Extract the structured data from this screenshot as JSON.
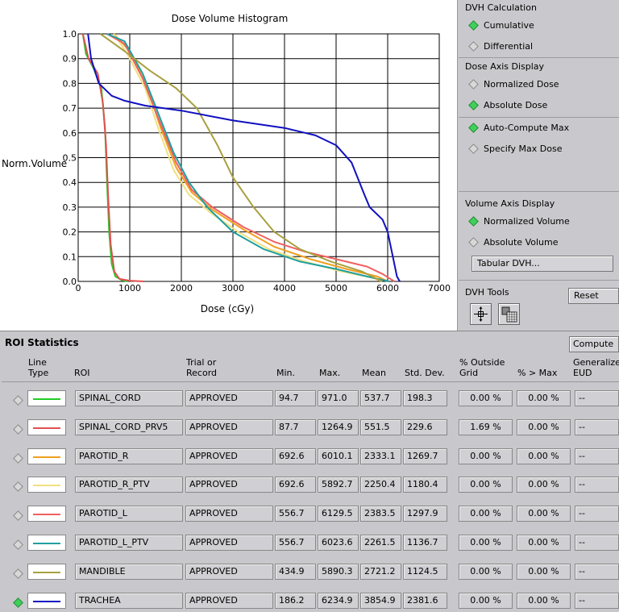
{
  "chart": {
    "title": "Dose Volume Histogram",
    "xlabel": "Dose (cGy)",
    "ylabel": "Norm.Volume",
    "x_ticks": [
      "0",
      "1000",
      "2000",
      "3000",
      "4000",
      "5000",
      "6000",
      "7000"
    ],
    "y_ticks": [
      "0.0",
      "0.1",
      "0.2",
      "0.3",
      "0.4",
      "0.5",
      "0.6",
      "0.7",
      "0.8",
      "0.9",
      "1.0"
    ]
  },
  "chart_data": {
    "type": "line",
    "title": "Dose Volume Histogram",
    "xlabel": "Dose (cGy)",
    "ylabel": "Norm.Volume",
    "xlim": [
      0,
      7000
    ],
    "ylim": [
      0,
      1.0
    ],
    "grid": true,
    "series": [
      {
        "name": "SPINAL_CORD",
        "color": "#22cc22",
        "points": [
          [
            90,
            1.0
          ],
          [
            150,
            0.92
          ],
          [
            300,
            0.86
          ],
          [
            450,
            0.78
          ],
          [
            520,
            0.62
          ],
          [
            560,
            0.4
          ],
          [
            600,
            0.2
          ],
          [
            650,
            0.07
          ],
          [
            720,
            0.02
          ],
          [
            850,
            0.005
          ],
          [
            971,
            0.0
          ]
        ]
      },
      {
        "name": "SPINAL_CORD_PRV5",
        "color": "#e05050",
        "points": [
          [
            90,
            1.0
          ],
          [
            200,
            0.9
          ],
          [
            380,
            0.84
          ],
          [
            480,
            0.72
          ],
          [
            540,
            0.55
          ],
          [
            580,
            0.35
          ],
          [
            630,
            0.15
          ],
          [
            700,
            0.04
          ],
          [
            800,
            0.01
          ],
          [
            1000,
            0.003
          ],
          [
            1265,
            0.0
          ]
        ]
      },
      {
        "name": "PAROTID_R",
        "color": "#f0a020",
        "points": [
          [
            690,
            1.0
          ],
          [
            1000,
            0.93
          ],
          [
            1350,
            0.78
          ],
          [
            1600,
            0.62
          ],
          [
            1900,
            0.46
          ],
          [
            2200,
            0.36
          ],
          [
            2600,
            0.29
          ],
          [
            3200,
            0.21
          ],
          [
            3800,
            0.14
          ],
          [
            4500,
            0.09
          ],
          [
            5200,
            0.05
          ],
          [
            5800,
            0.02
          ],
          [
            6010,
            0.0
          ]
        ]
      },
      {
        "name": "PAROTID_R_PTV",
        "color": "#f0e080",
        "points": [
          [
            690,
            1.0
          ],
          [
            950,
            0.92
          ],
          [
            1300,
            0.78
          ],
          [
            1550,
            0.62
          ],
          [
            1850,
            0.45
          ],
          [
            2150,
            0.35
          ],
          [
            2550,
            0.28
          ],
          [
            3100,
            0.2
          ],
          [
            3700,
            0.13
          ],
          [
            4400,
            0.08
          ],
          [
            5100,
            0.04
          ],
          [
            5700,
            0.015
          ],
          [
            5893,
            0.0
          ]
        ]
      },
      {
        "name": "PAROTID_L",
        "color": "#f06060",
        "points": [
          [
            560,
            1.0
          ],
          [
            900,
            0.96
          ],
          [
            1250,
            0.82
          ],
          [
            1550,
            0.66
          ],
          [
            1900,
            0.48
          ],
          [
            2200,
            0.37
          ],
          [
            2600,
            0.3
          ],
          [
            3200,
            0.22
          ],
          [
            3800,
            0.16
          ],
          [
            4400,
            0.12
          ],
          [
            5000,
            0.09
          ],
          [
            5600,
            0.06
          ],
          [
            5900,
            0.03
          ],
          [
            6130,
            0.0
          ]
        ]
      },
      {
        "name": "PAROTID_L_PTV",
        "color": "#20a0a0",
        "points": [
          [
            560,
            1.0
          ],
          [
            900,
            0.97
          ],
          [
            1250,
            0.84
          ],
          [
            1550,
            0.68
          ],
          [
            1850,
            0.52
          ],
          [
            2150,
            0.4
          ],
          [
            2500,
            0.3
          ],
          [
            3000,
            0.2
          ],
          [
            3600,
            0.13
          ],
          [
            4300,
            0.08
          ],
          [
            5000,
            0.05
          ],
          [
            5600,
            0.02
          ],
          [
            6024,
            0.0
          ]
        ]
      },
      {
        "name": "MANDIBLE",
        "color": "#a8a040",
        "points": [
          [
            430,
            1.0
          ],
          [
            900,
            0.93
          ],
          [
            1400,
            0.85
          ],
          [
            1900,
            0.78
          ],
          [
            2300,
            0.7
          ],
          [
            2700,
            0.55
          ],
          [
            3000,
            0.42
          ],
          [
            3400,
            0.3
          ],
          [
            3800,
            0.2
          ],
          [
            4300,
            0.13
          ],
          [
            4900,
            0.08
          ],
          [
            5500,
            0.04
          ],
          [
            5890,
            0.0
          ]
        ]
      },
      {
        "name": "TRACHEA",
        "color": "#1010c0",
        "points": [
          [
            190,
            1.0
          ],
          [
            250,
            0.9
          ],
          [
            400,
            0.8
          ],
          [
            650,
            0.75
          ],
          [
            900,
            0.73
          ],
          [
            1300,
            0.71
          ],
          [
            2000,
            0.69
          ],
          [
            3000,
            0.65
          ],
          [
            4000,
            0.62
          ],
          [
            4600,
            0.59
          ],
          [
            5000,
            0.55
          ],
          [
            5300,
            0.48
          ],
          [
            5550,
            0.35
          ],
          [
            5650,
            0.3
          ],
          [
            5900,
            0.25
          ],
          [
            6000,
            0.2
          ],
          [
            6100,
            0.1
          ],
          [
            6180,
            0.02
          ],
          [
            6235,
            0.0
          ]
        ]
      }
    ]
  },
  "side": {
    "dvh_calc": {
      "title": "DVH Calculation",
      "options": [
        {
          "label": "Cumulative",
          "on": true
        },
        {
          "label": "Differential",
          "on": false
        }
      ]
    },
    "dose_axis": {
      "title": "Dose Axis Display",
      "options": [
        {
          "label": "Normalized Dose",
          "on": false
        },
        {
          "label": "Absolute Dose",
          "on": true
        }
      ]
    },
    "dose_max": {
      "options": [
        {
          "label": "Auto-Compute Max",
          "on": true
        },
        {
          "label": "Specify Max Dose",
          "on": false
        }
      ]
    },
    "volume_axis": {
      "title": "Volume Axis Display",
      "options": [
        {
          "label": "Normalized Volume",
          "on": true
        },
        {
          "label": "Absolute Volume",
          "on": false
        }
      ],
      "tabular_button": "Tabular DVH..."
    },
    "tools": {
      "title": "DVH Tools",
      "reset_button": "Reset",
      "icons": [
        "crosshair-tool-icon",
        "grid-tool-icon"
      ]
    }
  },
  "stats": {
    "title": "ROI Statistics",
    "compute_button": "Compute",
    "headers": {
      "line_type": "Line\nType",
      "roi": "ROI",
      "trial": "Trial or\nRecord",
      "min": "Min.",
      "max": "Max.",
      "mean": "Mean",
      "std": "Std. Dev.",
      "outside": "% Outside\nGrid",
      "pct_max": "% > Max",
      "eud": "Generalized\nEUD"
    },
    "rows": [
      {
        "selected": false,
        "color": "#22cc22",
        "roi": "SPINAL_CORD",
        "trial": "APPROVED",
        "min": "94.7",
        "max": "971.0",
        "mean": "537.7",
        "std": "198.3",
        "outside": "0.00 %",
        "pct_max": "0.00 %",
        "eud": "--"
      },
      {
        "selected": false,
        "color": "#e05050",
        "roi": "SPINAL_CORD_PRV5",
        "trial": "APPROVED",
        "min": "87.7",
        "max": "1264.9",
        "mean": "551.5",
        "std": "229.6",
        "outside": "1.69 %",
        "pct_max": "0.00 %",
        "eud": "--"
      },
      {
        "selected": false,
        "color": "#f0a020",
        "roi": "PAROTID_R",
        "trial": "APPROVED",
        "min": "692.6",
        "max": "6010.1",
        "mean": "2333.1",
        "std": "1269.7",
        "outside": "0.00 %",
        "pct_max": "0.00 %",
        "eud": "--"
      },
      {
        "selected": false,
        "color": "#f0e080",
        "roi": "PAROTID_R_PTV",
        "trial": "APPROVED",
        "min": "692.6",
        "max": "5892.7",
        "mean": "2250.4",
        "std": "1180.4",
        "outside": "0.00 %",
        "pct_max": "0.00 %",
        "eud": "--"
      },
      {
        "selected": false,
        "color": "#f06060",
        "roi": "PAROTID_L",
        "trial": "APPROVED",
        "min": "556.7",
        "max": "6129.5",
        "mean": "2383.5",
        "std": "1297.9",
        "outside": "0.00 %",
        "pct_max": "0.00 %",
        "eud": "--"
      },
      {
        "selected": false,
        "color": "#20a0a0",
        "roi": "PAROTID_L_PTV",
        "trial": "APPROVED",
        "min": "556.7",
        "max": "6023.6",
        "mean": "2261.5",
        "std": "1136.7",
        "outside": "0.00 %",
        "pct_max": "0.00 %",
        "eud": "--"
      },
      {
        "selected": false,
        "color": "#a8a040",
        "roi": "MANDIBLE",
        "trial": "APPROVED",
        "min": "434.9",
        "max": "5890.3",
        "mean": "2721.2",
        "std": "1124.5",
        "outside": "0.00 %",
        "pct_max": "0.00 %",
        "eud": "--"
      },
      {
        "selected": true,
        "color": "#1010c0",
        "roi": "TRACHEA",
        "trial": "APPROVED",
        "min": "186.2",
        "max": "6234.9",
        "mean": "3854.9",
        "std": "2381.6",
        "outside": "0.00 %",
        "pct_max": "0.00 %",
        "eud": "--"
      }
    ]
  }
}
